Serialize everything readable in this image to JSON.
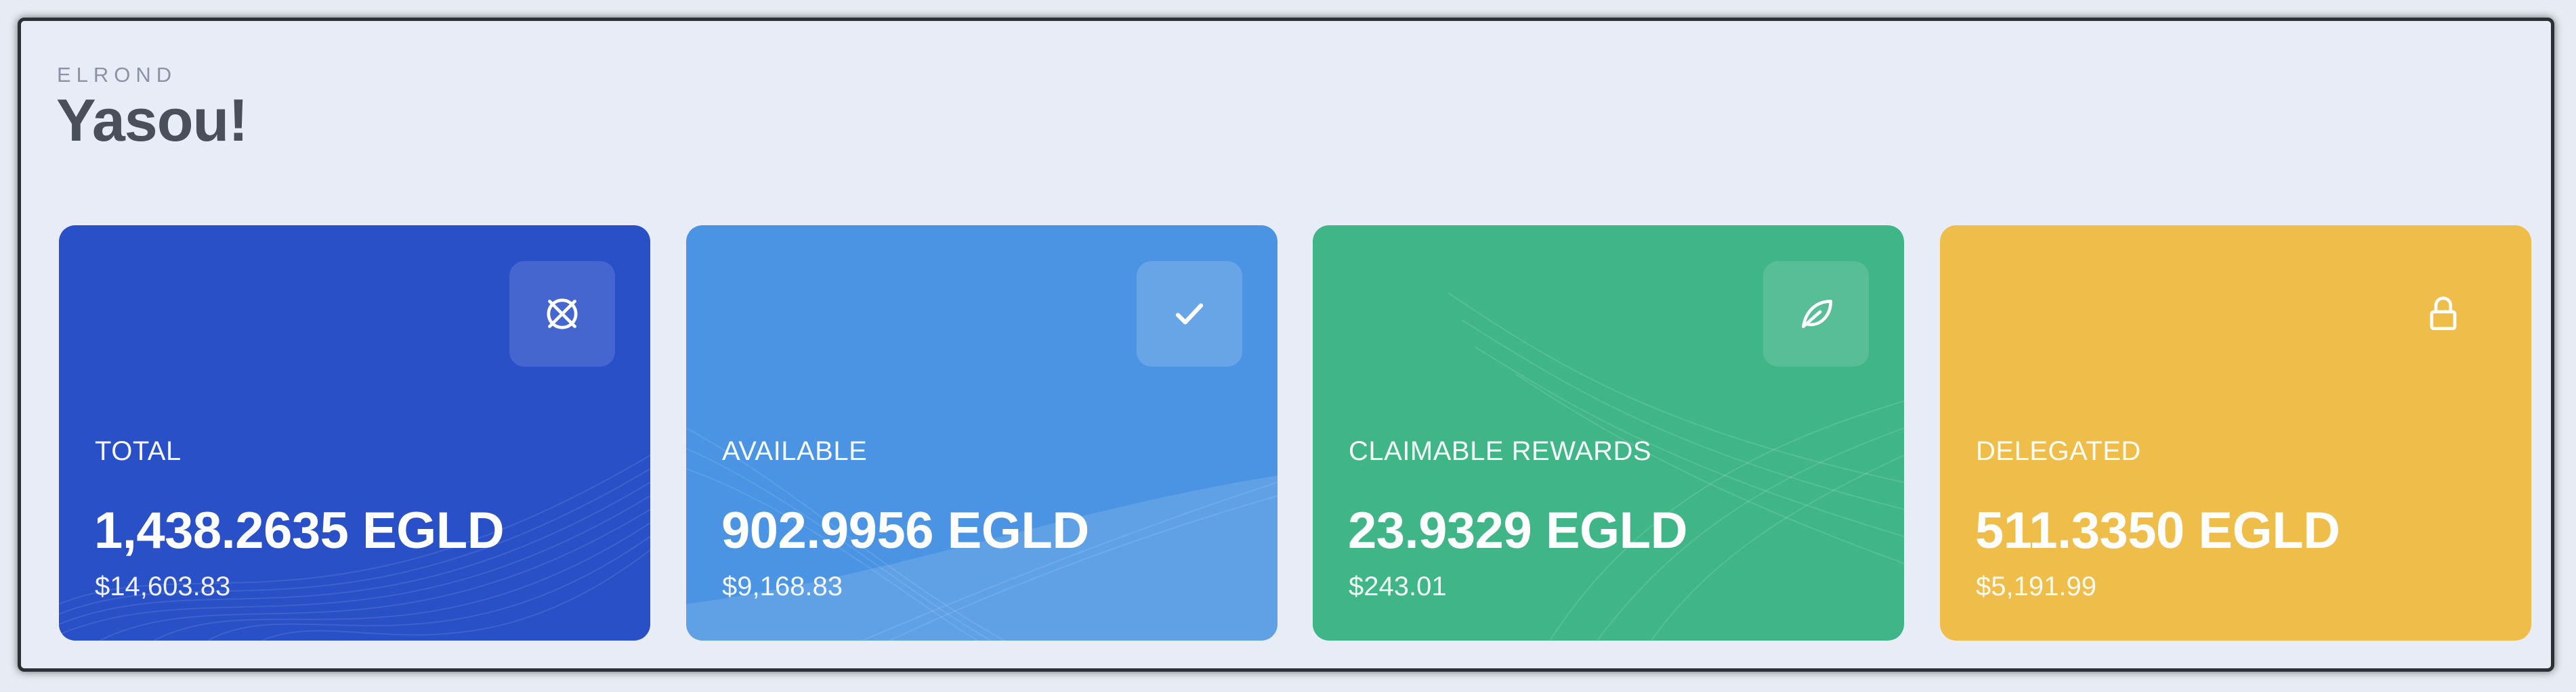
{
  "header": {
    "eyebrow": "ELROND",
    "title": "Yasou!"
  },
  "cards": [
    {
      "id": "total",
      "label": "TOTAL",
      "amount": "1,438.2635 EGLD",
      "usd": "$14,603.83",
      "icon": "elrond-logo-icon",
      "color": "#2a50c7"
    },
    {
      "id": "available",
      "label": "AVAILABLE",
      "amount": "902.9956 EGLD",
      "usd": "$9,168.83",
      "icon": "checkmark-icon",
      "color": "#4a94e3"
    },
    {
      "id": "claimable",
      "label": "CLAIMABLE REWARDS",
      "amount": "23.9329 EGLD",
      "usd": "$243.01",
      "icon": "leaf-icon",
      "color": "#3fb588"
    },
    {
      "id": "delegated",
      "label": "DELEGATED",
      "amount": "511.3350 EGLD",
      "usd": "$5,191.99",
      "icon": "lock-icon",
      "color": "#efbe4a"
    }
  ]
}
